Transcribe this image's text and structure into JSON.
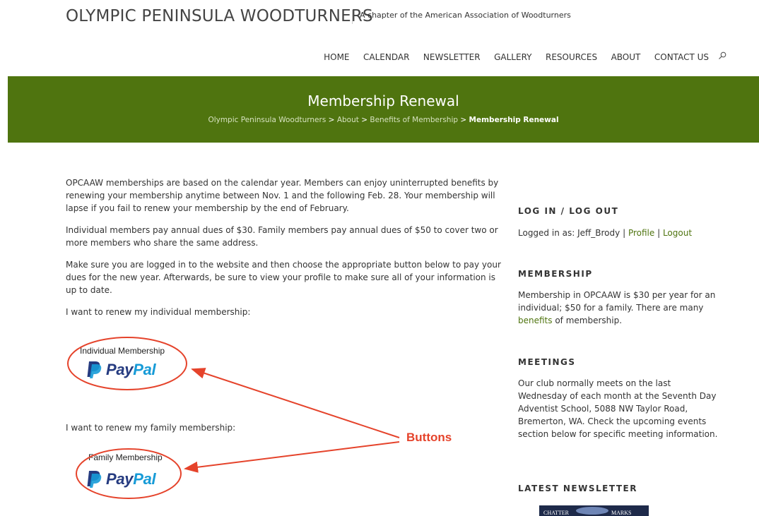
{
  "site": {
    "title": "OLYMPIC PENINSULA WOODTURNERS",
    "tagline": "A chapter of the American Association of Woodturners"
  },
  "nav": {
    "items": [
      "HOME",
      "CALENDAR",
      "NEWSLETTER",
      "GALLERY",
      "RESOURCES",
      "ABOUT",
      "CONTACT US"
    ],
    "search_icon": "search-icon"
  },
  "banner": {
    "title": "Membership Renewal",
    "breadcrumb": [
      "Olympic Peninsula Woodturners",
      "About",
      "Benefits of Membership",
      "Membership Renewal"
    ],
    "separator": ">",
    "background_color": "#4f740f"
  },
  "content": {
    "paragraphs": [
      "OPCAAW memberships are based on the calendar year. Members can enjoy uninterrupted benefits by renewing your membership anytime between Nov. 1 and the following Feb. 28. Your membership will lapse if you fail to renew your membership by the end of February.",
      "Individual members pay annual dues of $30. Family members pay annual dues of $50 to cover two or more members who share the same address.",
      "Make sure you are logged in to the website and then choose the appropriate button below to pay your dues for the new year. Afterwards, be sure to view your profile to make sure all of your information is up to date.",
      "I want to renew my individual membership:"
    ],
    "individual_button": {
      "label": "Individual Membership",
      "pay": "Pay",
      "pal": "Pal"
    },
    "family_intro": "I want to renew my family membership:",
    "family_button": {
      "label": "Family Membership",
      "pay": "Pay",
      "pal": "Pal"
    },
    "annotation": "Buttons",
    "annotation_color": "#e5432b"
  },
  "sidebar": {
    "login": {
      "title": "LOG IN / LOG OUT",
      "logged_in_as": "Logged in as: Jeff_Brody",
      "sep": "|",
      "profile": "Profile",
      "logout": "Logout"
    },
    "membership": {
      "title": "MEMBERSHIP",
      "text_before": "Membership in OPCAAW is $30 per year for an individual; $50 for a family. There are many ",
      "link": "benefits",
      "text_after": " of membership."
    },
    "meetings": {
      "title": "MEETINGS",
      "text": "Our club normally meets on the last Wednesday of each month at the Seventh Day Adventist School, 5088 NW Taylor Road, Bremerton, WA. Check the upcoming events section below for specific meeting information."
    },
    "newsletter": {
      "title": "LATEST NEWSLETTER",
      "thumb_left": "CHATTER",
      "thumb_right": "MARKS"
    }
  }
}
